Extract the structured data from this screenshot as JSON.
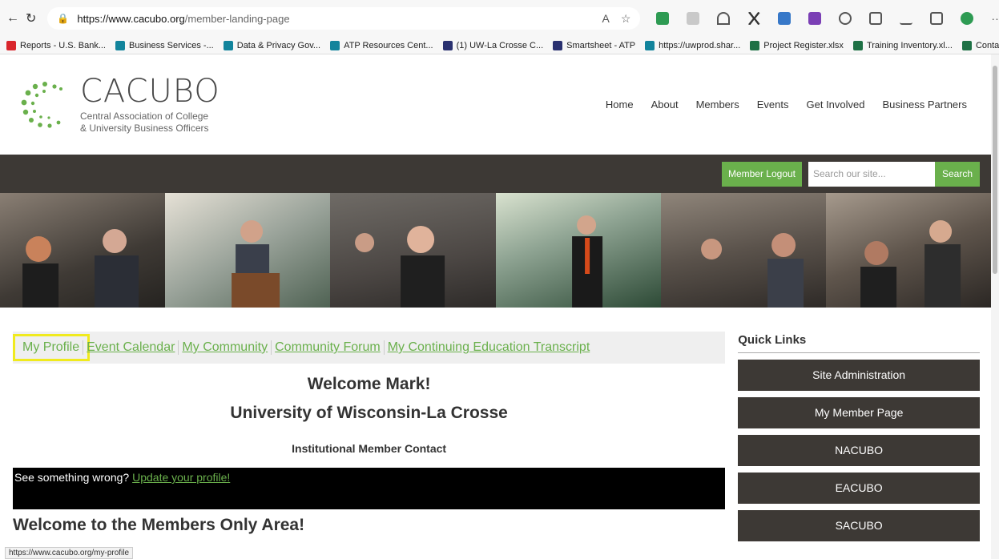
{
  "browser": {
    "url_host": "https://www.cacubo.org",
    "url_path": "/member-landing-page",
    "status_url": "https://www.cacubo.org/my-profile",
    "bookmarks": [
      {
        "label": "Reports - U.S. Bank...",
        "color": "#d9262c"
      },
      {
        "label": "Business Services -...",
        "color": "#12849c"
      },
      {
        "label": "Data & Privacy Gov...",
        "color": "#12849c"
      },
      {
        "label": "ATP Resources Cent...",
        "color": "#12849c"
      },
      {
        "label": "(1) UW-La Crosse C...",
        "color": "#2a3170"
      },
      {
        "label": "Smartsheet - ATP",
        "color": "#2a3170"
      },
      {
        "label": "https://uwprod.shar...",
        "color": "#12849c"
      },
      {
        "label": "Project Register.xlsx",
        "color": "#1e7145"
      },
      {
        "label": "Training Inventory.xl...",
        "color": "#1e7145"
      },
      {
        "label": "Contact Information...",
        "color": "#1e7145"
      }
    ]
  },
  "header": {
    "logo_title": "CACUBO",
    "logo_sub1": "Central Association of College",
    "logo_sub2": "& University Business Officers",
    "nav": [
      "Home",
      "About",
      "Members",
      "Events",
      "Get Involved",
      "Business Partners"
    ]
  },
  "toolbar": {
    "logout_label": "Member Logout",
    "search_placeholder": "Search our site...",
    "search_label": "Search"
  },
  "tabs": [
    "My Profile",
    "Event Calendar",
    "My Community",
    "Community Forum",
    "My Continuing Education Transcript"
  ],
  "main": {
    "welcome": "Welcome Mark!",
    "university": "University of Wisconsin-La Crosse",
    "role": "Institutional Member Contact",
    "notice_text": "See something wrong? ",
    "notice_link": "Update your profile!",
    "members_title": "Welcome to the Members Only Area!"
  },
  "quick_links": {
    "title": "Quick Links",
    "items": [
      "Site Administration",
      "My Member Page",
      "NACUBO",
      "EACUBO",
      "SACUBO"
    ]
  },
  "colors": {
    "accent": "#6ab04c",
    "dark": "#3d3935",
    "highlight": "#f0ea1e"
  }
}
